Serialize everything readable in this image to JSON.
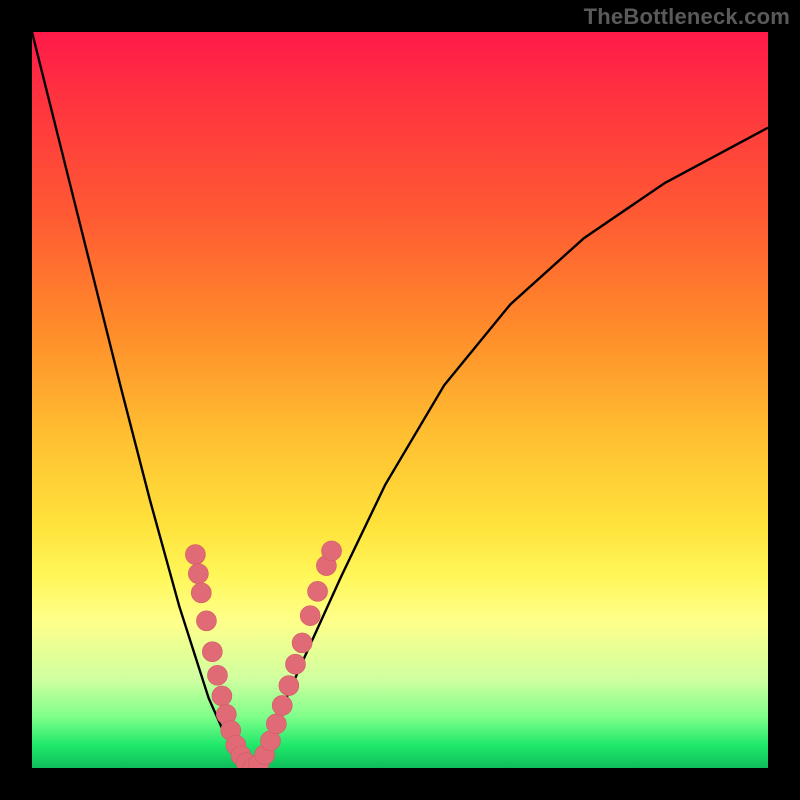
{
  "watermark": "TheBottleneck.com",
  "chart_data": {
    "type": "line",
    "title": "",
    "xlabel": "",
    "ylabel": "",
    "xlim": [
      0,
      1
    ],
    "ylim": [
      0,
      1
    ],
    "grid": false,
    "series": [
      {
        "name": "left-branch",
        "x": [
          0.0,
          0.04,
          0.08,
          0.12,
          0.16,
          0.2,
          0.24,
          0.26,
          0.28,
          0.3
        ],
        "y": [
          1.0,
          0.84,
          0.68,
          0.52,
          0.365,
          0.22,
          0.095,
          0.05,
          0.015,
          0.0
        ]
      },
      {
        "name": "right-branch",
        "x": [
          0.3,
          0.33,
          0.37,
          0.42,
          0.48,
          0.56,
          0.65,
          0.75,
          0.86,
          1.0
        ],
        "y": [
          0.0,
          0.06,
          0.15,
          0.26,
          0.385,
          0.52,
          0.63,
          0.72,
          0.795,
          0.87
        ]
      }
    ],
    "markers": {
      "name": "highlight-points",
      "color": "#e06a75",
      "radius": 10,
      "points": [
        {
          "x": 0.222,
          "y": 0.29
        },
        {
          "x": 0.226,
          "y": 0.264
        },
        {
          "x": 0.23,
          "y": 0.238
        },
        {
          "x": 0.237,
          "y": 0.2
        },
        {
          "x": 0.245,
          "y": 0.158
        },
        {
          "x": 0.252,
          "y": 0.126
        },
        {
          "x": 0.258,
          "y": 0.098
        },
        {
          "x": 0.264,
          "y": 0.073
        },
        {
          "x": 0.27,
          "y": 0.051
        },
        {
          "x": 0.277,
          "y": 0.031
        },
        {
          "x": 0.284,
          "y": 0.017
        },
        {
          "x": 0.291,
          "y": 0.007
        },
        {
          "x": 0.3,
          "y": 0.0
        },
        {
          "x": 0.308,
          "y": 0.005
        },
        {
          "x": 0.316,
          "y": 0.018
        },
        {
          "x": 0.324,
          "y": 0.037
        },
        {
          "x": 0.332,
          "y": 0.06
        },
        {
          "x": 0.34,
          "y": 0.085
        },
        {
          "x": 0.349,
          "y": 0.112
        },
        {
          "x": 0.358,
          "y": 0.141
        },
        {
          "x": 0.367,
          "y": 0.17
        },
        {
          "x": 0.378,
          "y": 0.207
        },
        {
          "x": 0.388,
          "y": 0.24
        },
        {
          "x": 0.4,
          "y": 0.275
        },
        {
          "x": 0.407,
          "y": 0.295
        }
      ]
    },
    "gradient_stops": [
      {
        "pos": 0.0,
        "color": "#ff1a4a"
      },
      {
        "pos": 0.25,
        "color": "#ff5a33"
      },
      {
        "pos": 0.55,
        "color": "#ffc031"
      },
      {
        "pos": 0.75,
        "color": "#fff75a"
      },
      {
        "pos": 0.9,
        "color": "#7fff8a"
      },
      {
        "pos": 1.0,
        "color": "#0fbd5a"
      }
    ]
  }
}
